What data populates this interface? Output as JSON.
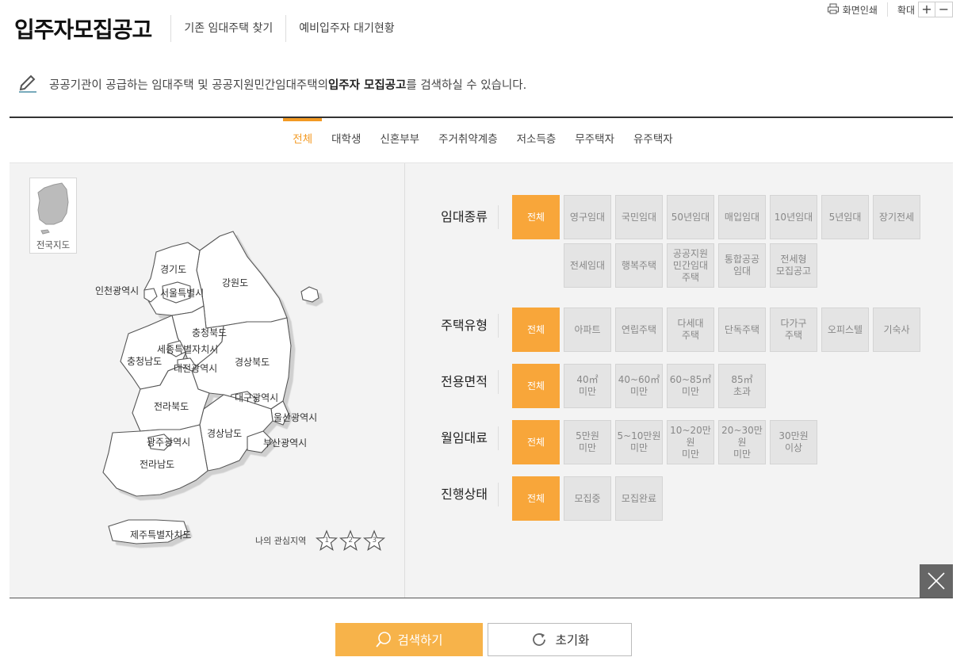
{
  "utils": {
    "print_label": "화면인쇄",
    "zoom_label": "확대",
    "zoom_in": "+",
    "zoom_out": "−"
  },
  "header": {
    "title": "입주자모집공고",
    "links": [
      "기존 임대주택 찾기",
      "예비입주자 대기현황"
    ]
  },
  "intro": {
    "before": "공공기관이 공급하는 임대주택 및 공공지원민간임대주택의 ",
    "highlight": "입주자 모집공고",
    "after": "를 검색하실 수 있습니다."
  },
  "tabs": [
    {
      "label": "전체",
      "active": true
    },
    {
      "label": "대학생",
      "active": false
    },
    {
      "label": "신혼부부",
      "active": false
    },
    {
      "label": "주거취약계층",
      "active": false
    },
    {
      "label": "저소득층",
      "active": false
    },
    {
      "label": "무주택자",
      "active": false
    },
    {
      "label": "유주택자",
      "active": false
    }
  ],
  "map": {
    "mini_label": "전국지도",
    "regions": {
      "gyeonggi": "경기도",
      "incheon": "인천광역시",
      "seoul": "서울특별시",
      "gangwon": "강원도",
      "chungbuk": "충청북도",
      "sejong": "세종특별자치시",
      "chungnam": "충청남도",
      "daejeon": "대전광역시",
      "gyeongbuk": "경상북도",
      "daegu": "대구광역시",
      "jeonbuk": "전라북도",
      "ulsan": "울산광역시",
      "gyeongnam": "경상남도",
      "gwangju": "광주광역시",
      "busan": "부산광역시",
      "jeonnam": "전라남도",
      "jeju": "제주특별자치도"
    },
    "interest_label": "나의 관심지역",
    "stars": [
      "1",
      "2",
      "3"
    ]
  },
  "filters": {
    "rental_type": {
      "label": "임대종류",
      "options": [
        "전체",
        "영구임대",
        "국민임대",
        "50년임대",
        "매입임대",
        "10년임대",
        "5년임대",
        "장기전세",
        "전세임대",
        "행복주택",
        "공공지원\n민간임대\n주택",
        "통합공공\n임대",
        "전세형\n모집공고"
      ]
    },
    "house_type": {
      "label": "주택유형",
      "options": [
        "전체",
        "아파트",
        "연립주택",
        "다세대\n주택",
        "단독주택",
        "다가구\n주택",
        "오피스텔",
        "기숙사"
      ]
    },
    "area": {
      "label": "전용면적",
      "options": [
        "전체",
        "40㎡\n미만",
        "40~60㎡\n미만",
        "60~85㎡\n미만",
        "85㎡\n초과"
      ]
    },
    "rent": {
      "label": "월임대료",
      "options": [
        "전체",
        "5만원\n미만",
        "5~10만원\n미만",
        "10~20만원\n미만",
        "20~30만원\n미만",
        "30만원\n이상"
      ]
    },
    "status": {
      "label": "진행상태",
      "options": [
        "전체",
        "모집중",
        "모집완료"
      ]
    }
  },
  "actions": {
    "search": "검색하기",
    "reset": "초기화"
  },
  "colors": {
    "accent": "#f39a23",
    "active_option": "#f8a63a",
    "search_button": "#f7b34a"
  }
}
